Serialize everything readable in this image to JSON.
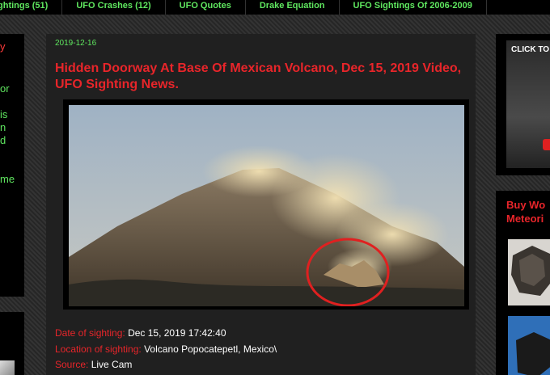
{
  "nav": [
    "ghtings (51)",
    "UFO Crashes (12)",
    "UFO Quotes",
    "Drake Equation",
    "UFO Sightings Of 2006-2009"
  ],
  "left_fragments": [
    "y",
    "or",
    "is",
    "n",
    "d",
    "me"
  ],
  "post": {
    "date": "2019-12-16",
    "title": "Hidden Doorway At Base Of Mexican Volcano, Dec 15, 2019 Video, UFO Sighting News.",
    "details": [
      {
        "label": "Date of sighting:",
        "value": "Dec 15, 2019 17:42:40"
      },
      {
        "label": "Location of sighting:",
        "value": "Volcano Popocatepetl, Mexico\\"
      },
      {
        "label": "Source:",
        "value": "Live Cam"
      }
    ]
  },
  "sidebar": {
    "ad1_text": "CLICK TO S",
    "ad2_title_line1": "Buy Wo",
    "ad2_title_line2": "Meteori"
  },
  "colors": {
    "accent_green": "#5fe65f",
    "accent_red": "#e8252a",
    "circle": "#e02020"
  }
}
